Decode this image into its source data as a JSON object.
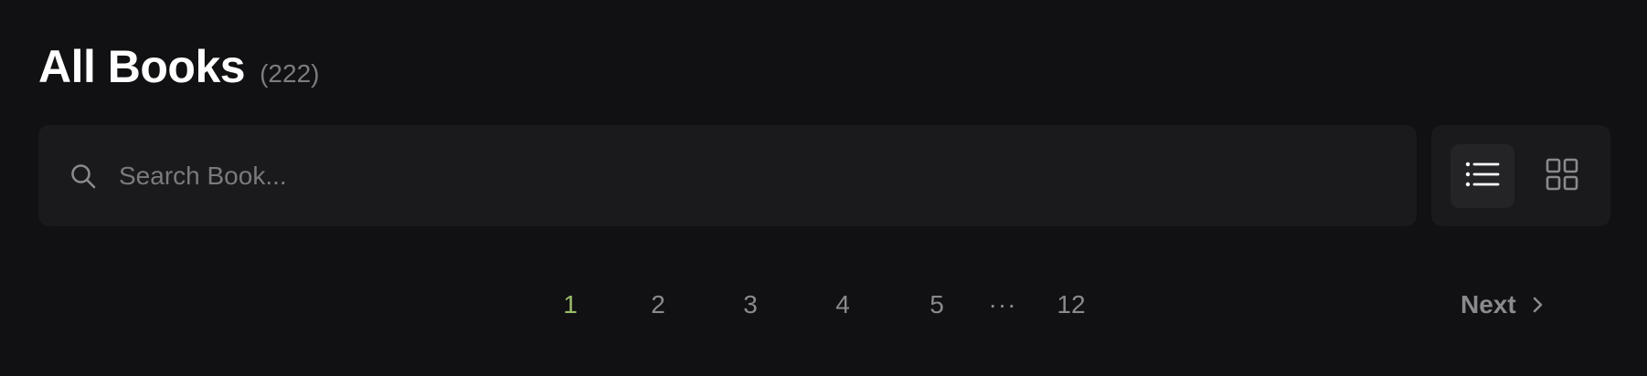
{
  "header": {
    "title": "All Books",
    "count": "(222)"
  },
  "search": {
    "placeholder": "Search Book...",
    "value": "",
    "icon": "search-icon"
  },
  "view_toggle": {
    "options": [
      {
        "name": "list",
        "icon": "list-view-icon",
        "active": true
      },
      {
        "name": "grid",
        "icon": "grid-view-icon",
        "active": false
      }
    ]
  },
  "pagination": {
    "pages": [
      "1",
      "2",
      "3",
      "4",
      "5"
    ],
    "ellipsis": "···",
    "last_page": "12",
    "current": "1",
    "next_label": "Next"
  },
  "colors": {
    "background": "#111113",
    "surface": "#1a1a1c",
    "active_page": "#9bbd6a",
    "muted_text": "#8a8a8e"
  }
}
